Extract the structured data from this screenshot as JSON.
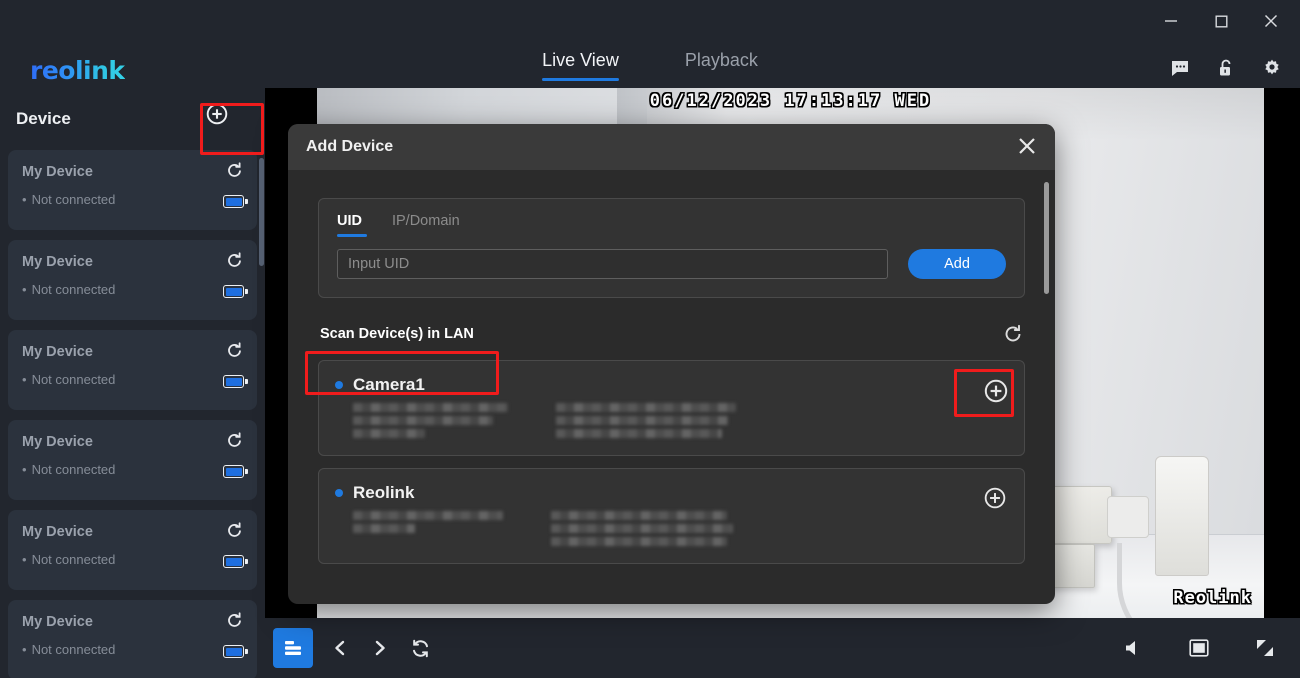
{
  "window": {
    "minimize_icon": "minimize-icon",
    "maximize_icon": "maximize-icon",
    "close_icon": "close-icon"
  },
  "brand": {
    "logo_text": "reolink"
  },
  "nav": {
    "tabs": [
      {
        "label": "Live View",
        "active": true
      },
      {
        "label": "Playback",
        "active": false
      }
    ]
  },
  "top_icons": [
    {
      "name": "message-icon"
    },
    {
      "name": "unlock-icon"
    },
    {
      "name": "gear-icon"
    }
  ],
  "sidebar": {
    "title": "Device",
    "add_button_icon": "plus-circle-icon",
    "devices": [
      {
        "name": "My Device",
        "status": "Not connected"
      },
      {
        "name": "My Device",
        "status": "Not connected"
      },
      {
        "name": "My Device",
        "status": "Not connected"
      },
      {
        "name": "My Device",
        "status": "Not connected"
      },
      {
        "name": "My Device",
        "status": "Not connected"
      },
      {
        "name": "My Device",
        "status": "Not connected"
      }
    ]
  },
  "video": {
    "timestamp": "06/12/2023  17:13:17  WED",
    "watermark": "Reolink"
  },
  "bottom_bar": {
    "layout_button": "layout-grid-icon",
    "prev_icon": "chevron-left-icon",
    "next_icon": "chevron-right-icon",
    "refresh_icon": "refresh-icon",
    "volume_icon": "speaker-icon",
    "pip_icon": "picture-in-picture-icon",
    "fullscreen_icon": "fullscreen-icon"
  },
  "modal": {
    "title": "Add Device",
    "close_icon": "close-icon",
    "tabs": [
      {
        "label": "UID",
        "active": true
      },
      {
        "label": "IP/Domain",
        "active": false
      }
    ],
    "input_placeholder": "Input UID",
    "input_value": "",
    "add_label": "Add",
    "scan_label": "Scan Device(s) in LAN",
    "scan_refresh_icon": "refresh-icon",
    "found_devices": [
      {
        "name": "Camera1",
        "add_icon": "plus-circle-icon",
        "highlighted": true
      },
      {
        "name": "Reolink",
        "add_icon": "plus-circle-icon",
        "highlighted": false
      }
    ]
  },
  "colors": {
    "accent_blue": "#1f7ae0",
    "highlight_red": "#f01c1c",
    "window_bg": "#22262e",
    "modal_bg": "#2b2b2b"
  }
}
